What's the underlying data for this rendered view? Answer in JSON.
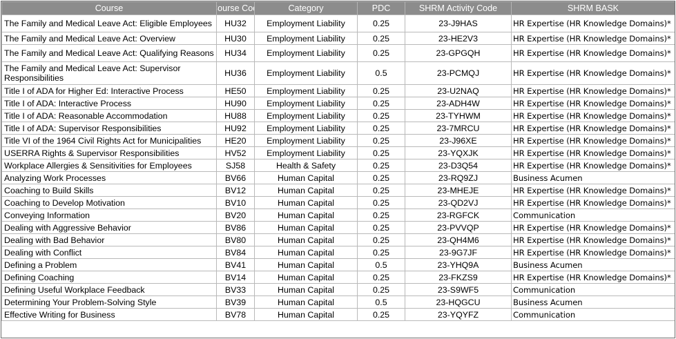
{
  "headers": [
    "Course",
    "Course Code",
    "Category",
    "PDC",
    "SHRM Activity Code",
    "SHRM BASK"
  ],
  "rows": [
    [
      "The Family and Medical Leave Act: Eligible Employees",
      "HU32",
      "Employment Liability",
      "0.25",
      "23-J9HAS",
      "HR Expertise (HR Knowledge Domains)*"
    ],
    [
      "The Family and Medical Leave Act: Overview",
      "HU30",
      "Employment Liability",
      "0.25",
      "23-HE2V3",
      "HR Expertise (HR Knowledge Domains)*"
    ],
    [
      "The Family and Medical Leave Act: Qualifying Reasons",
      "HU34",
      "Employment Liability",
      "0.25",
      "23-GPGQH",
      "HR Expertise (HR Knowledge Domains)*"
    ],
    [
      "The Family and Medical Leave Act: Supervisor Responsibilities",
      "HU36",
      "Employment Liability",
      "0.5",
      "23-PCMQJ",
      "HR Expertise (HR Knowledge Domains)*"
    ],
    [
      "Title I of ADA for Higher Ed: Interactive Process",
      "HE50",
      "Employment Liability",
      "0.25",
      "23-U2NAQ",
      "HR Expertise (HR Knowledge Domains)*"
    ],
    [
      "Title I of ADA: Interactive Process",
      "HU90",
      "Employment Liability",
      "0.25",
      "23-ADH4W",
      "HR Expertise (HR Knowledge Domains)*"
    ],
    [
      "Title I of ADA: Reasonable Accommodation",
      "HU88",
      "Employment Liability",
      "0.25",
      "23-TYHWM",
      "HR Expertise (HR Knowledge Domains)*"
    ],
    [
      "Title I of ADA: Supervisor Responsibilities",
      "HU92",
      "Employment Liability",
      "0.25",
      "23-7MRCU",
      "HR Expertise (HR Knowledge Domains)*"
    ],
    [
      "Title VI of the 1964 Civil Rights Act for Municipalities",
      "HE20",
      "Employment Liability",
      "0.25",
      "23-J96XE",
      "HR Expertise (HR Knowledge Domains)*"
    ],
    [
      "USERRA Rights & Supervisor Responsibilities",
      "HV52",
      "Employment Liability",
      "0.25",
      "23-YQXJK",
      "HR Expertise (HR Knowledge Domains)*"
    ],
    [
      "Workplace Allergies & Sensitivities for Employees",
      "SJ58",
      "Health & Safety",
      "0.25",
      "23-D3Q54",
      "HR Expertise (HR Knowledge Domains)*"
    ],
    [
      "Analyzing Work Processes",
      "BV66",
      "Human Capital",
      "0.25",
      "23-RQ9ZJ",
      "Business Acumen"
    ],
    [
      "Coaching to Build Skills",
      "BV12",
      "Human Capital",
      "0.25",
      "23-MHEJE",
      "HR Expertise (HR Knowledge Domains)*"
    ],
    [
      "Coaching to Develop Motivation",
      "BV10",
      "Human Capital",
      "0.25",
      "23-QD2VJ",
      "HR Expertise (HR Knowledge Domains)*"
    ],
    [
      "Conveying Information",
      "BV20",
      "Human Capital",
      "0.25",
      "23-RGFCK",
      "Communication"
    ],
    [
      "Dealing with Aggressive Behavior",
      "BV86",
      "Human Capital",
      "0.25",
      "23-PVVQP",
      "HR Expertise (HR Knowledge Domains)*"
    ],
    [
      "Dealing with Bad Behavior",
      "BV80",
      "Human Capital",
      "0.25",
      "23-QH4M6",
      "HR Expertise (HR Knowledge Domains)*"
    ],
    [
      "Dealing with Conflict",
      "BV84",
      "Human Capital",
      "0.25",
      "23-9G7JF",
      "HR Expertise (HR Knowledge Domains)*"
    ],
    [
      "Defining a Problem",
      "BV41",
      "Human Capital",
      "0.5",
      "23-YHQ9A",
      "Business Acumen"
    ],
    [
      "Defining Coaching",
      "BV14",
      "Human Capital",
      "0.25",
      "23-FKZS9",
      "HR Expertise (HR Knowledge Domains)*"
    ],
    [
      "Defining Useful Workplace Feedback",
      "BV33",
      "Human Capital",
      "0.25",
      "23-S9WF5",
      "Communication"
    ],
    [
      "Determining Your Problem-Solving Style",
      "BV39",
      "Human Capital",
      "0.5",
      "23-HQGCU",
      "Business Acumen"
    ],
    [
      "Effective Writing for Business",
      "BV78",
      "Human Capital",
      "0.25",
      "23-YQYFZ",
      "Communication"
    ]
  ]
}
